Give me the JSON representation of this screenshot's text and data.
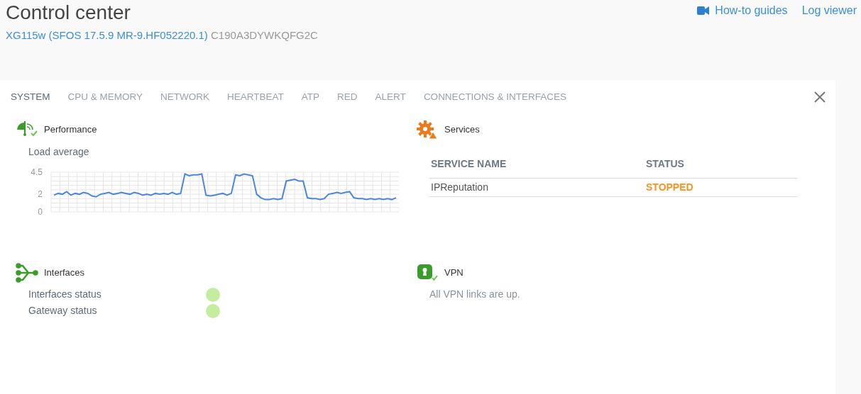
{
  "header": {
    "title": "Control center",
    "device": "XG115w (SFOS 17.5.9 MR-9.HF052220.1)",
    "serial": "C190A3DYWKQFG2C",
    "links": [
      {
        "label": "How-to guides",
        "kind": "video"
      },
      {
        "label": "Log viewer",
        "kind": "plain"
      }
    ]
  },
  "tabs": [
    {
      "label": "SYSTEM",
      "selected": true
    },
    {
      "label": "CPU & MEMORY",
      "selected": false
    },
    {
      "label": "NETWORK",
      "selected": false
    },
    {
      "label": "HEARTBEAT",
      "selected": false
    },
    {
      "label": "ATP",
      "selected": false
    },
    {
      "label": "RED",
      "selected": false
    },
    {
      "label": "ALERT",
      "selected": false
    },
    {
      "label": "CONNECTIONS & INTERFACES",
      "selected": false
    }
  ],
  "performance": {
    "title": "Performance",
    "chart_data": {
      "type": "line",
      "title": "Load average",
      "grid": true,
      "ylim": [
        0,
        4.5
      ],
      "yticks": [
        0,
        2,
        4.5
      ],
      "series": [
        {
          "color": "#4a86e0",
          "values": [
            1.9,
            2.1,
            2.0,
            2.3,
            1.9,
            2.1,
            2.0,
            2.2,
            2.1,
            1.8,
            1.7,
            2.0,
            2.1,
            2.2,
            2.0,
            2.1,
            2.2,
            2.1,
            2.0,
            2.2,
            2.1,
            1.9,
            2.0,
            1.9,
            2.1,
            2.0,
            2.1,
            2.0,
            2.2,
            2.0,
            2.1,
            4.3,
            4.1,
            4.2,
            4.2,
            4.3,
            1.9,
            1.8,
            1.9,
            2.0,
            2.1,
            1.9,
            2.1,
            4.2,
            4.1,
            4.3,
            4.2,
            4.1,
            2.0,
            1.6,
            1.4,
            1.4,
            1.5,
            1.4,
            1.5,
            3.5,
            3.6,
            3.7,
            3.5,
            3.5,
            1.6,
            1.5,
            1.5,
            1.4,
            1.5,
            2.0,
            2.1,
            2.2,
            2.1,
            2.2,
            2.3,
            1.6,
            1.5,
            1.5,
            1.4,
            1.5,
            1.4,
            1.5,
            1.4,
            1.5,
            1.4,
            1.6
          ]
        }
      ]
    }
  },
  "services": {
    "title": "Services",
    "columns": [
      "SERVICE NAME",
      "STATUS"
    ],
    "rows": [
      {
        "name": "IPReputation",
        "status": "STOPPED",
        "kind": "stopped"
      }
    ]
  },
  "interfaces": {
    "title": "Interfaces",
    "items": [
      {
        "label": "Interfaces status",
        "color": "#c6ec9f"
      },
      {
        "label": "Gateway status",
        "color": "#c6ec9f"
      }
    ]
  },
  "vpn": {
    "title": "VPN",
    "message": "All VPN links are up."
  }
}
